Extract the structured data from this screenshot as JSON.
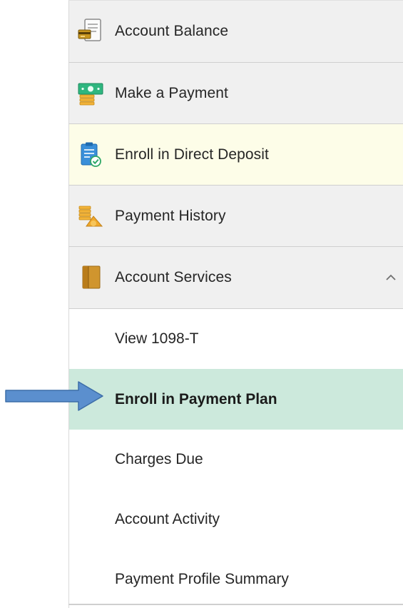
{
  "menu": {
    "items": [
      {
        "label": "Account Balance",
        "icon": "account-balance-icon"
      },
      {
        "label": "Make a Payment",
        "icon": "cash-payment-icon"
      },
      {
        "label": "Enroll in Direct Deposit",
        "icon": "direct-deposit-clipboard-icon"
      },
      {
        "label": "Payment History",
        "icon": "payment-history-icon"
      },
      {
        "label": "Account Services",
        "icon": "account-services-folder-icon",
        "expanded": true
      }
    ],
    "sub_items": [
      {
        "label": "View 1098-T"
      },
      {
        "label": "Enroll in Payment Plan",
        "active": true
      },
      {
        "label": "Charges Due"
      },
      {
        "label": "Account Activity"
      },
      {
        "label": "Payment Profile Summary"
      }
    ]
  },
  "colors": {
    "row_bg": "#f0f0f0",
    "highlight_row_bg": "#fdfde8",
    "active_sub_bg": "#cce9dc",
    "arrow_fill": "#5b8fce",
    "arrow_stroke": "#3d6ea8"
  },
  "annotation": {
    "icon": "pointer-arrow-icon"
  }
}
